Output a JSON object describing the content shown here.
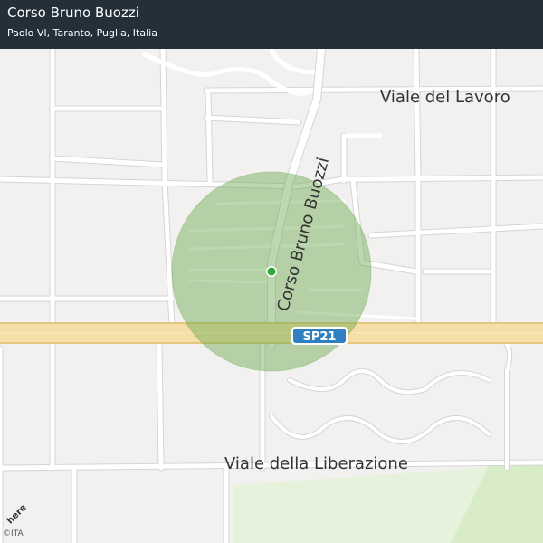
{
  "header": {
    "title": "Corso Bruno Buozzi",
    "subtitle": "Paolo VI, Taranto, Puglia, Italia"
  },
  "map": {
    "street_labels": {
      "corso": "Corso  Bruno  Buozzi",
      "viale_lavoro": "Viale  del  Lavoro",
      "viale_liberazione": "Viale  della  Liberazione"
    },
    "road_shield": "SP21",
    "colors": {
      "land": "#f2f1ef",
      "road": "#ffffff",
      "road_casing": "#d6d5d3",
      "highway": "#f5dfa6",
      "highway_casing": "#e3c77f",
      "park": "#e7f2dc",
      "radius_fill": "#6aa84f",
      "location_dot": "#2ea83a",
      "shield": "#2f7fc1",
      "header_bg": "#23303a"
    },
    "radius_circle": "accuracy-radius",
    "location_marker": "current-location"
  },
  "attribution": {
    "logo_text": "here",
    "copyright": "©ITA"
  }
}
